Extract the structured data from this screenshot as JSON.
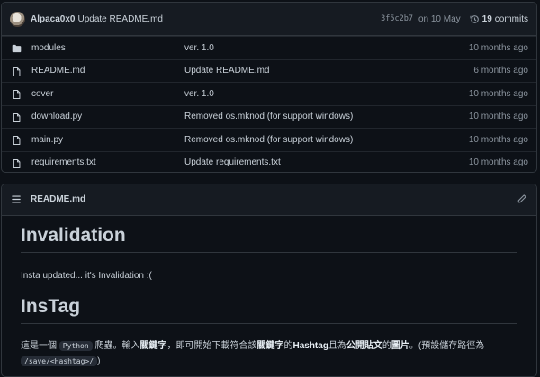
{
  "commit": {
    "author": "Alpaca0x0",
    "message": "Update README.md",
    "sha": "3f5c2b7",
    "date": "on 10 May",
    "commits_count": "19",
    "commits_label": "commits"
  },
  "files": [
    {
      "type": "folder",
      "name": "modules",
      "message": "ver. 1.0",
      "age": "10 months ago"
    },
    {
      "type": "file",
      "name": "README.md",
      "message": "Update README.md",
      "age": "6 months ago"
    },
    {
      "type": "file",
      "name": "cover",
      "message": "ver. 1.0",
      "age": "10 months ago"
    },
    {
      "type": "file",
      "name": "download.py",
      "message": "Removed os.mknod (for support windows)",
      "age": "10 months ago"
    },
    {
      "type": "file",
      "name": "main.py",
      "message": "Removed os.mknod (for support windows)",
      "age": "10 months ago"
    },
    {
      "type": "file",
      "name": "requirements.txt",
      "message": "Update requirements.txt",
      "age": "10 months ago"
    }
  ],
  "readme": {
    "title": "README.md",
    "h1_first": "Invalidation",
    "p_first": "Insta updated... it's Invalidation :(",
    "h1_second": "InsTag",
    "p2": {
      "t1": "這是一個",
      "code1": "Python",
      "t2": "爬蟲。輸入",
      "b1": "關鍵字",
      "t3": "，即可開始下載符合該",
      "b2": "關鍵字",
      "t4": "的",
      "b3": "Hashtag",
      "t5": "且為",
      "b4": "公開貼文",
      "t6": "的",
      "b5": "圖片",
      "t7": "。(預設儲存路徑為",
      "code2": "/save/<Hashtag>/",
      "t8": ")"
    }
  },
  "icons": {
    "avatar": "avatar",
    "history": "history-icon",
    "folder": "folder-icon",
    "file": "file-icon",
    "list": "list-icon",
    "edit": "pencil-icon"
  }
}
